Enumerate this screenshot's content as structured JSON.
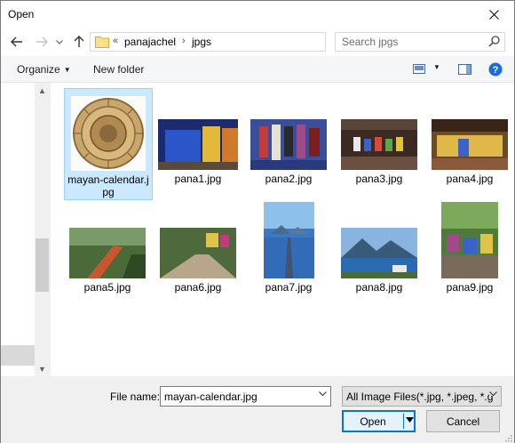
{
  "window": {
    "title": "Open"
  },
  "address": {
    "overflow": "«",
    "crumbs": [
      "panajachel",
      "jpgs"
    ]
  },
  "search": {
    "placeholder": "Search jpgs"
  },
  "toolbar": {
    "organize_label": "Organize",
    "new_folder_label": "New folder"
  },
  "files": [
    {
      "name": "mayan-calendar.jpg",
      "selected": true
    },
    {
      "name": "pana1.jpg"
    },
    {
      "name": "pana2.jpg"
    },
    {
      "name": "pana3.jpg"
    },
    {
      "name": "pana4.jpg"
    },
    {
      "name": "pana5.jpg"
    },
    {
      "name": "pana6.jpg"
    },
    {
      "name": "pana7.jpg"
    },
    {
      "name": "pana8.jpg"
    },
    {
      "name": "pana9.jpg"
    }
  ],
  "footer": {
    "file_name_label": "File name:",
    "file_name_value": "mayan-calendar.jpg",
    "file_type_value": "All Image Files(*.jpg, *.jpeg, *.g",
    "open_label": "Open",
    "cancel_label": "Cancel"
  },
  "colors": {
    "selection": "#cce8ff",
    "accent": "#0078d7",
    "help": "#1e6bd6"
  }
}
